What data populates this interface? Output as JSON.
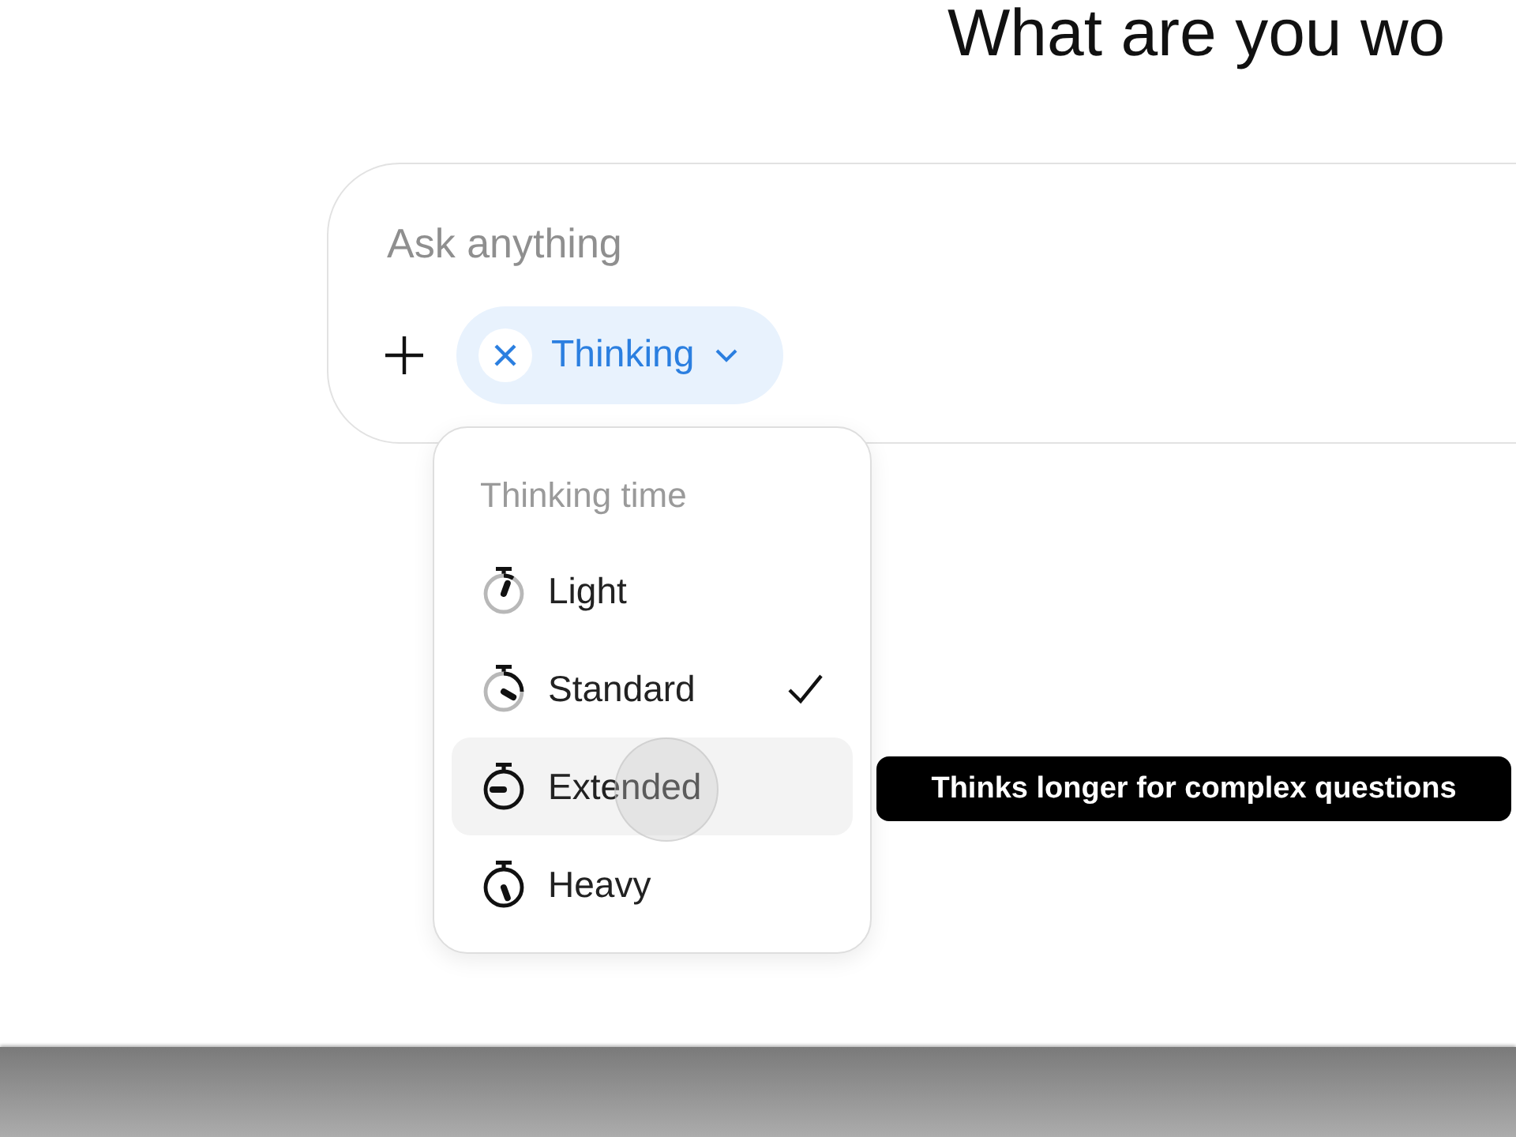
{
  "heading": "What are you wo",
  "composer": {
    "placeholder": "Ask anything",
    "mode_chip": {
      "label": "Thinking",
      "active": true
    }
  },
  "menu": {
    "title": "Thinking time",
    "items": [
      {
        "label": "Light",
        "selected": false,
        "hovered": false
      },
      {
        "label": "Standard",
        "selected": true,
        "hovered": false
      },
      {
        "label": "Extended",
        "selected": false,
        "hovered": true
      },
      {
        "label": "Heavy",
        "selected": false,
        "hovered": false
      }
    ]
  },
  "tooltip": "Thinks longer for complex questions"
}
